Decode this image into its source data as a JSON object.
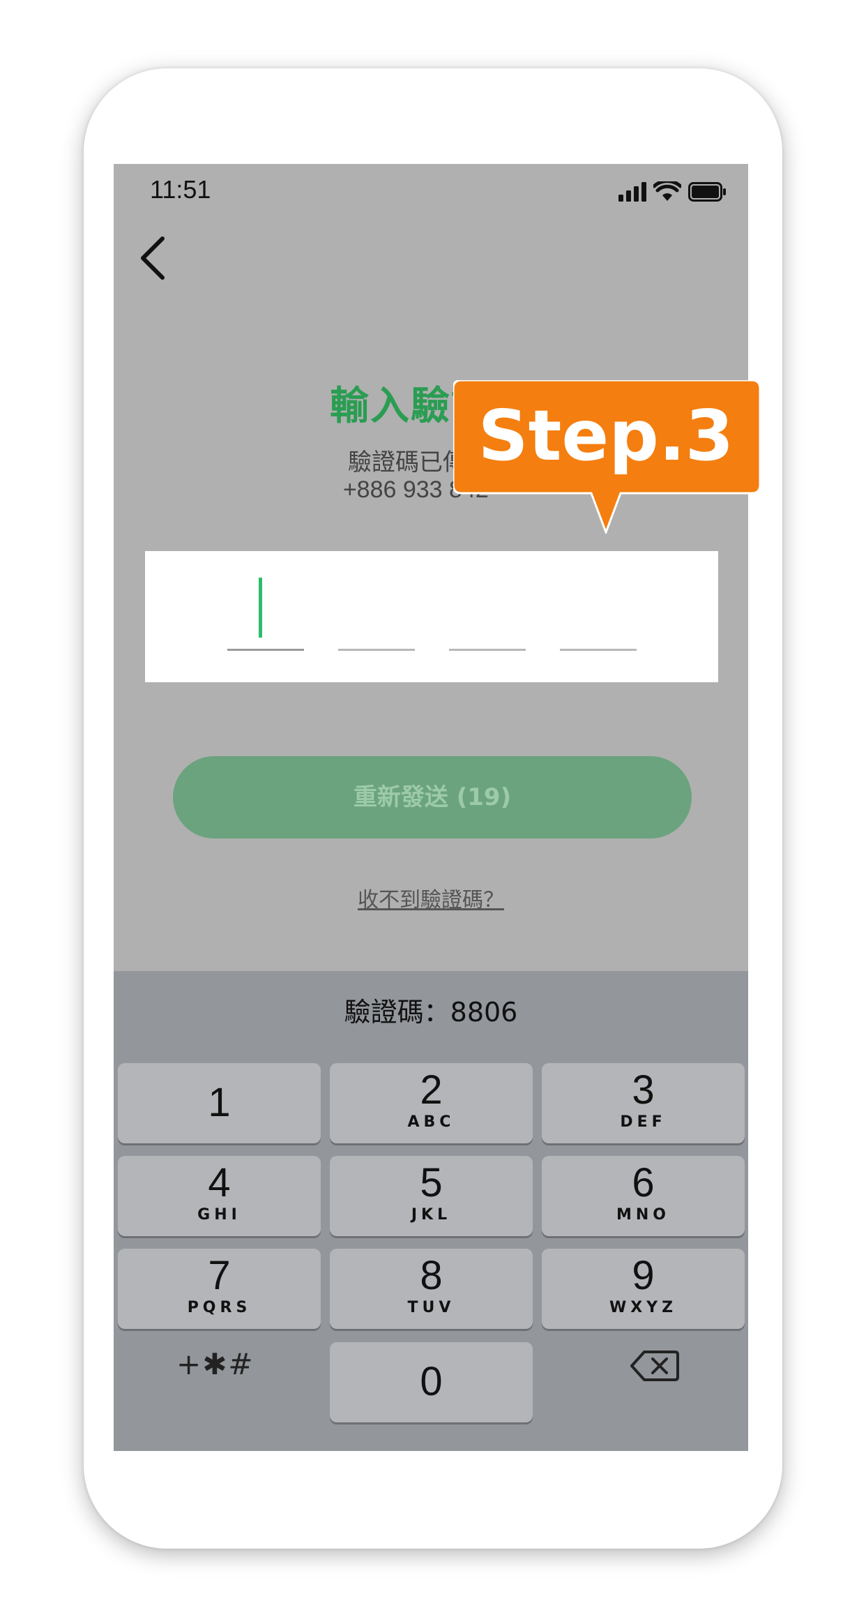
{
  "status_bar": {
    "time": "11:51"
  },
  "page": {
    "title": "輸入驗證碼",
    "subtitle": "驗證碼已傳送至",
    "phone_number": "+886 933 842 ···"
  },
  "resend_button": {
    "label": "重新發送 (19)"
  },
  "help_link": {
    "label": "收不到驗證碼？"
  },
  "keyboard": {
    "suggestion": "驗證碼：8806",
    "keys": [
      {
        "num": "1",
        "letters": ""
      },
      {
        "num": "2",
        "letters": "ABC"
      },
      {
        "num": "3",
        "letters": "DEF"
      },
      {
        "num": "4",
        "letters": "GHI"
      },
      {
        "num": "5",
        "letters": "JKL"
      },
      {
        "num": "6",
        "letters": "MNO"
      },
      {
        "num": "7",
        "letters": "PQRS"
      },
      {
        "num": "8",
        "letters": "TUV"
      },
      {
        "num": "9",
        "letters": "WXYZ"
      },
      {
        "num": "0",
        "letters": ""
      }
    ],
    "symbols_label": "+✱#"
  },
  "callout": {
    "label": "Step.3",
    "color": "#f47e0f"
  },
  "colors": {
    "accent_green": "#2a9d52",
    "cursor_green": "#2dbd6a",
    "button_green": "#6ba37e"
  }
}
